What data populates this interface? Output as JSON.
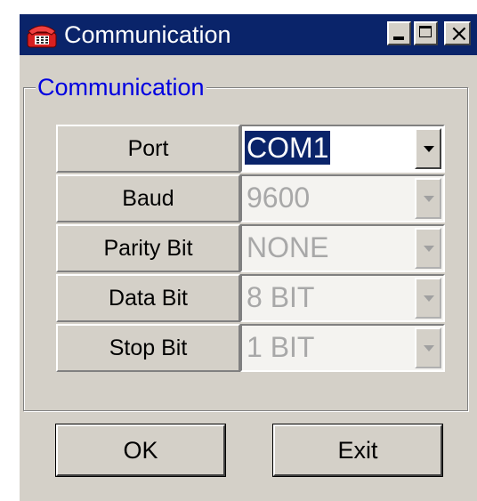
{
  "window": {
    "title": "Communication",
    "icon": "telephone-icon"
  },
  "title_buttons": {
    "minimize": "minimize-icon",
    "maximize": "maximize-icon",
    "close": "×"
  },
  "group": {
    "label": "Communication"
  },
  "rows": [
    {
      "label": "Port",
      "value": "COM1"
    },
    {
      "label": "Baud",
      "value": "9600"
    },
    {
      "label": "Parity Bit",
      "value": "NONE"
    },
    {
      "label": "Data Bit",
      "value": "8 BIT"
    },
    {
      "label": "Stop Bit",
      "value": "1 BIT"
    }
  ],
  "buttons": {
    "ok": "OK",
    "exit": "Exit"
  },
  "colors": {
    "titlebar": "#0a246a",
    "group_label": "#0000e0",
    "face": "#d4d0c8"
  }
}
